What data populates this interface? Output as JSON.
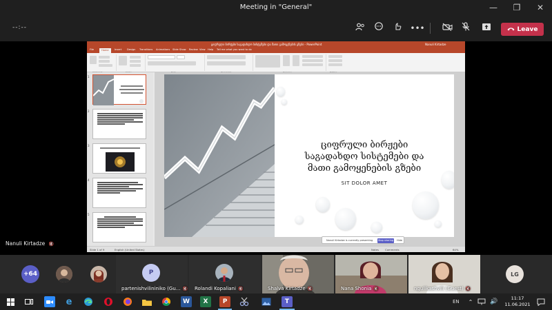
{
  "window": {
    "title": "Meeting in \"General\""
  },
  "toolbar": {
    "timer": "--:--",
    "leave_label": "Leave",
    "icons": [
      "people-icon",
      "chat-icon",
      "reactions-icon",
      "more-icon",
      "camera-off-icon",
      "mic-off-icon",
      "share-icon"
    ]
  },
  "presenter": {
    "name": "Nanuli Kirtadze"
  },
  "ppt": {
    "doc_title": "ციფრული ბირჟები საგადახდო სისტემები და მათი გამოყენების გზები - PowerPoint",
    "user": "Nanuli Kirtadze",
    "tabs": [
      "File",
      "Home",
      "Insert",
      "Design",
      "Transitions",
      "Animations",
      "Slide Show",
      "Review",
      "View",
      "Help",
      "Tell me what you want to do"
    ],
    "ribbon_groups": [
      "Clipboard",
      "Slides",
      "Font",
      "Paragraph",
      "Drawing",
      "Editing"
    ],
    "slide": {
      "title_lines": [
        "ციფრული ბირჟები",
        "საგადახდო სისტემები და",
        "მათი გამოყენების გზები"
      ],
      "subtitle": "SIT DOLOR AMET"
    },
    "status": {
      "slide_of": "Slide 1 of 9",
      "language": "English (United States)",
      "notes": "Notes",
      "comments": "Comments",
      "zoom": "64%"
    },
    "prompt": {
      "message": "Nanuli Kirtadze is currently presenting",
      "take_control": "Stop sharing",
      "dismiss": "Hide"
    }
  },
  "participants": {
    "overflow_count": "+64",
    "tiles": [
      {
        "name": "partenishvilininiko (Gu...",
        "initial": "P"
      },
      {
        "name": "Rolandi Kopaliani",
        "initial": ""
      },
      {
        "name": "Shalva Kirtadze",
        "initial": ""
      },
      {
        "name": "Nana Shonia",
        "initial": ""
      },
      {
        "name": "ngulikashvili (Guest)",
        "initial": ""
      },
      {
        "name": "",
        "initial": "LG"
      }
    ]
  },
  "taskbar": {
    "language": "EN",
    "time": "11:17",
    "date": "11.06.2021"
  },
  "colors": {
    "leave": "#c4314b",
    "ppt_accent": "#b7472a",
    "teams_purple": "#5b5fc7"
  }
}
